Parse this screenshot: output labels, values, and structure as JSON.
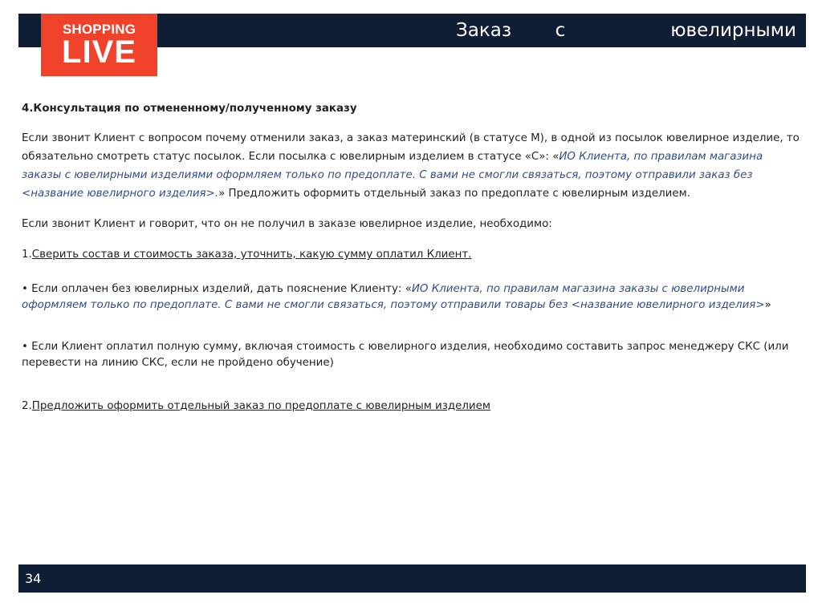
{
  "header": {
    "title_word1": "Заказ",
    "title_word2": "с",
    "title_word3": "ювелирными"
  },
  "logo": {
    "line1": "SHOPPING",
    "line2": "LIVE"
  },
  "content": {
    "section_title": "4.Консультация по отмененному/полученному заказу",
    "para1_plain": "Если звонит Клиент с вопросом почему отменили заказ, а заказ материнский (в статусе М), в одной из посылок ювелирное изделие, то обязательно смотреть статус посылок. Если посылка с ювелирным изделием в статусе «С»: «",
    "para1_quote": "ИО Клиента, по правилам магазина заказы с ювелирными изделиями оформляем только по предоплате. С вами не смогли связаться, поэтому отправили заказ без <название ювелирного изделия>.",
    "para1_end": "» Предложить оформить отдельный заказ по предоплате с ювелирным изделием.",
    "para2": "Если звонит Клиент и говорит, что он не получил в заказе ювелирное изделие, необходимо:",
    "step1_num": "1.",
    "step1_text": "Сверить состав и стоимость заказа, уточнить, какую сумму оплатил Клиент.",
    "bullet1_plain": "• Если оплачен без ювелирных изделий, дать пояснение Клиенту: «",
    "bullet1_quote": "ИО Клиента, по правилам магазина заказы с ювелирными оформляем только по предоплате. С вами не смогли связаться, поэтому отправили товары без <название ювелирного изделия>",
    "bullet1_end": "»",
    "bullet2": "• Если Клиент оплатил полную сумму, включая стоимость с ювелирного изделия,  необходимо составить запрос менеджеру СКС (или перевести на линию СКС, если не пройдено обучение)",
    "step2_num": "2.",
    "step2_text": "Предложить оформить отдельный заказ по предоплате с ювелирным изделием"
  },
  "footer": {
    "page_number": "34"
  },
  "colors": {
    "header_bg": "#0f1e35",
    "logo_bg": "#f0412b",
    "quote_text": "#2f4d87"
  }
}
